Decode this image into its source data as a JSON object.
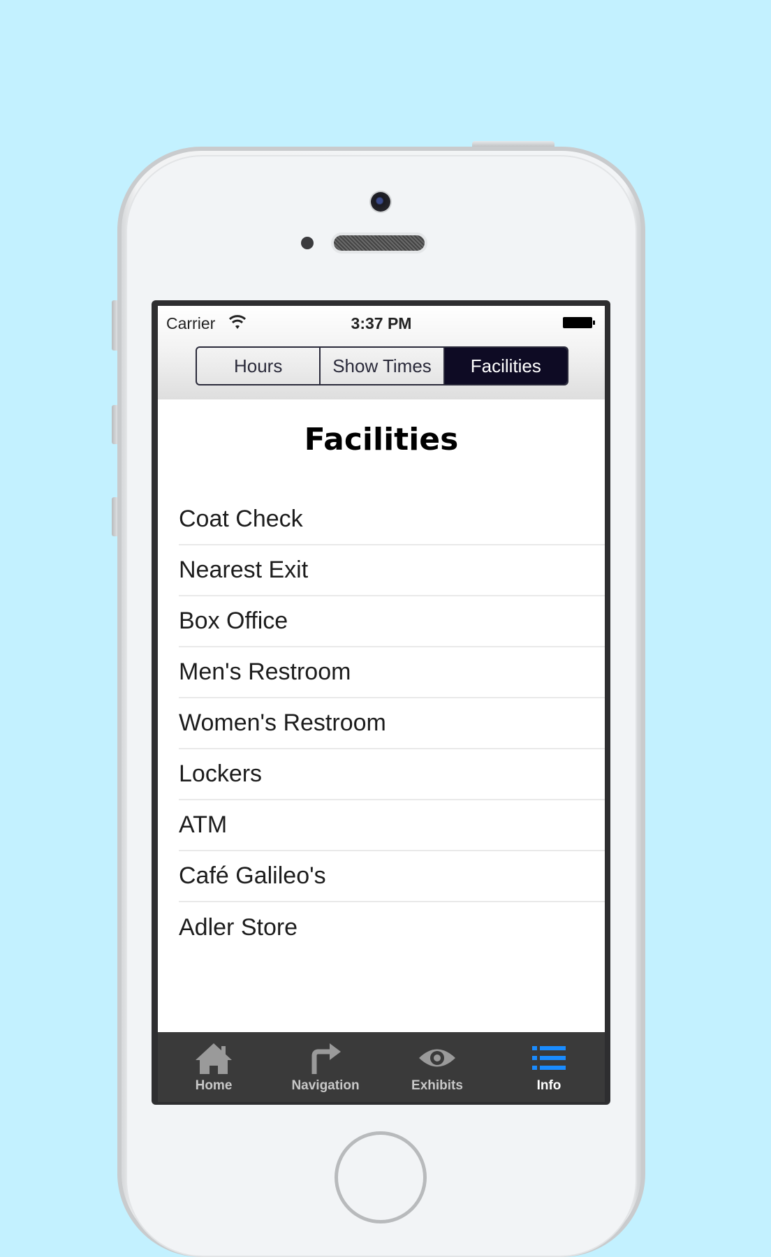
{
  "status_bar": {
    "carrier": "Carrier",
    "time": "3:37 PM"
  },
  "segmented_control": {
    "segments": [
      {
        "label": "Hours",
        "selected": false
      },
      {
        "label": "Show Times",
        "selected": false
      },
      {
        "label": "Facilities",
        "selected": true
      }
    ]
  },
  "page": {
    "title": "Facilities"
  },
  "facilities": [
    "Coat Check",
    "Nearest Exit",
    "Box Office",
    "Men's Restroom",
    "Women's Restroom",
    "Lockers",
    "ATM",
    "Café Galileo's",
    "Adler Store"
  ],
  "tab_bar": {
    "tabs": [
      {
        "label": "Home",
        "icon": "house-icon",
        "active": false
      },
      {
        "label": "Navigation",
        "icon": "turn-arrow-icon",
        "active": false
      },
      {
        "label": "Exhibits",
        "icon": "eye-icon",
        "active": false
      },
      {
        "label": "Info",
        "icon": "list-icon",
        "active": true
      }
    ],
    "active_color": "#1a8cff",
    "inactive_color": "#9a9a9a"
  },
  "colors": {
    "background": "#c3f1ff",
    "segment_active": "#0e0b24"
  }
}
